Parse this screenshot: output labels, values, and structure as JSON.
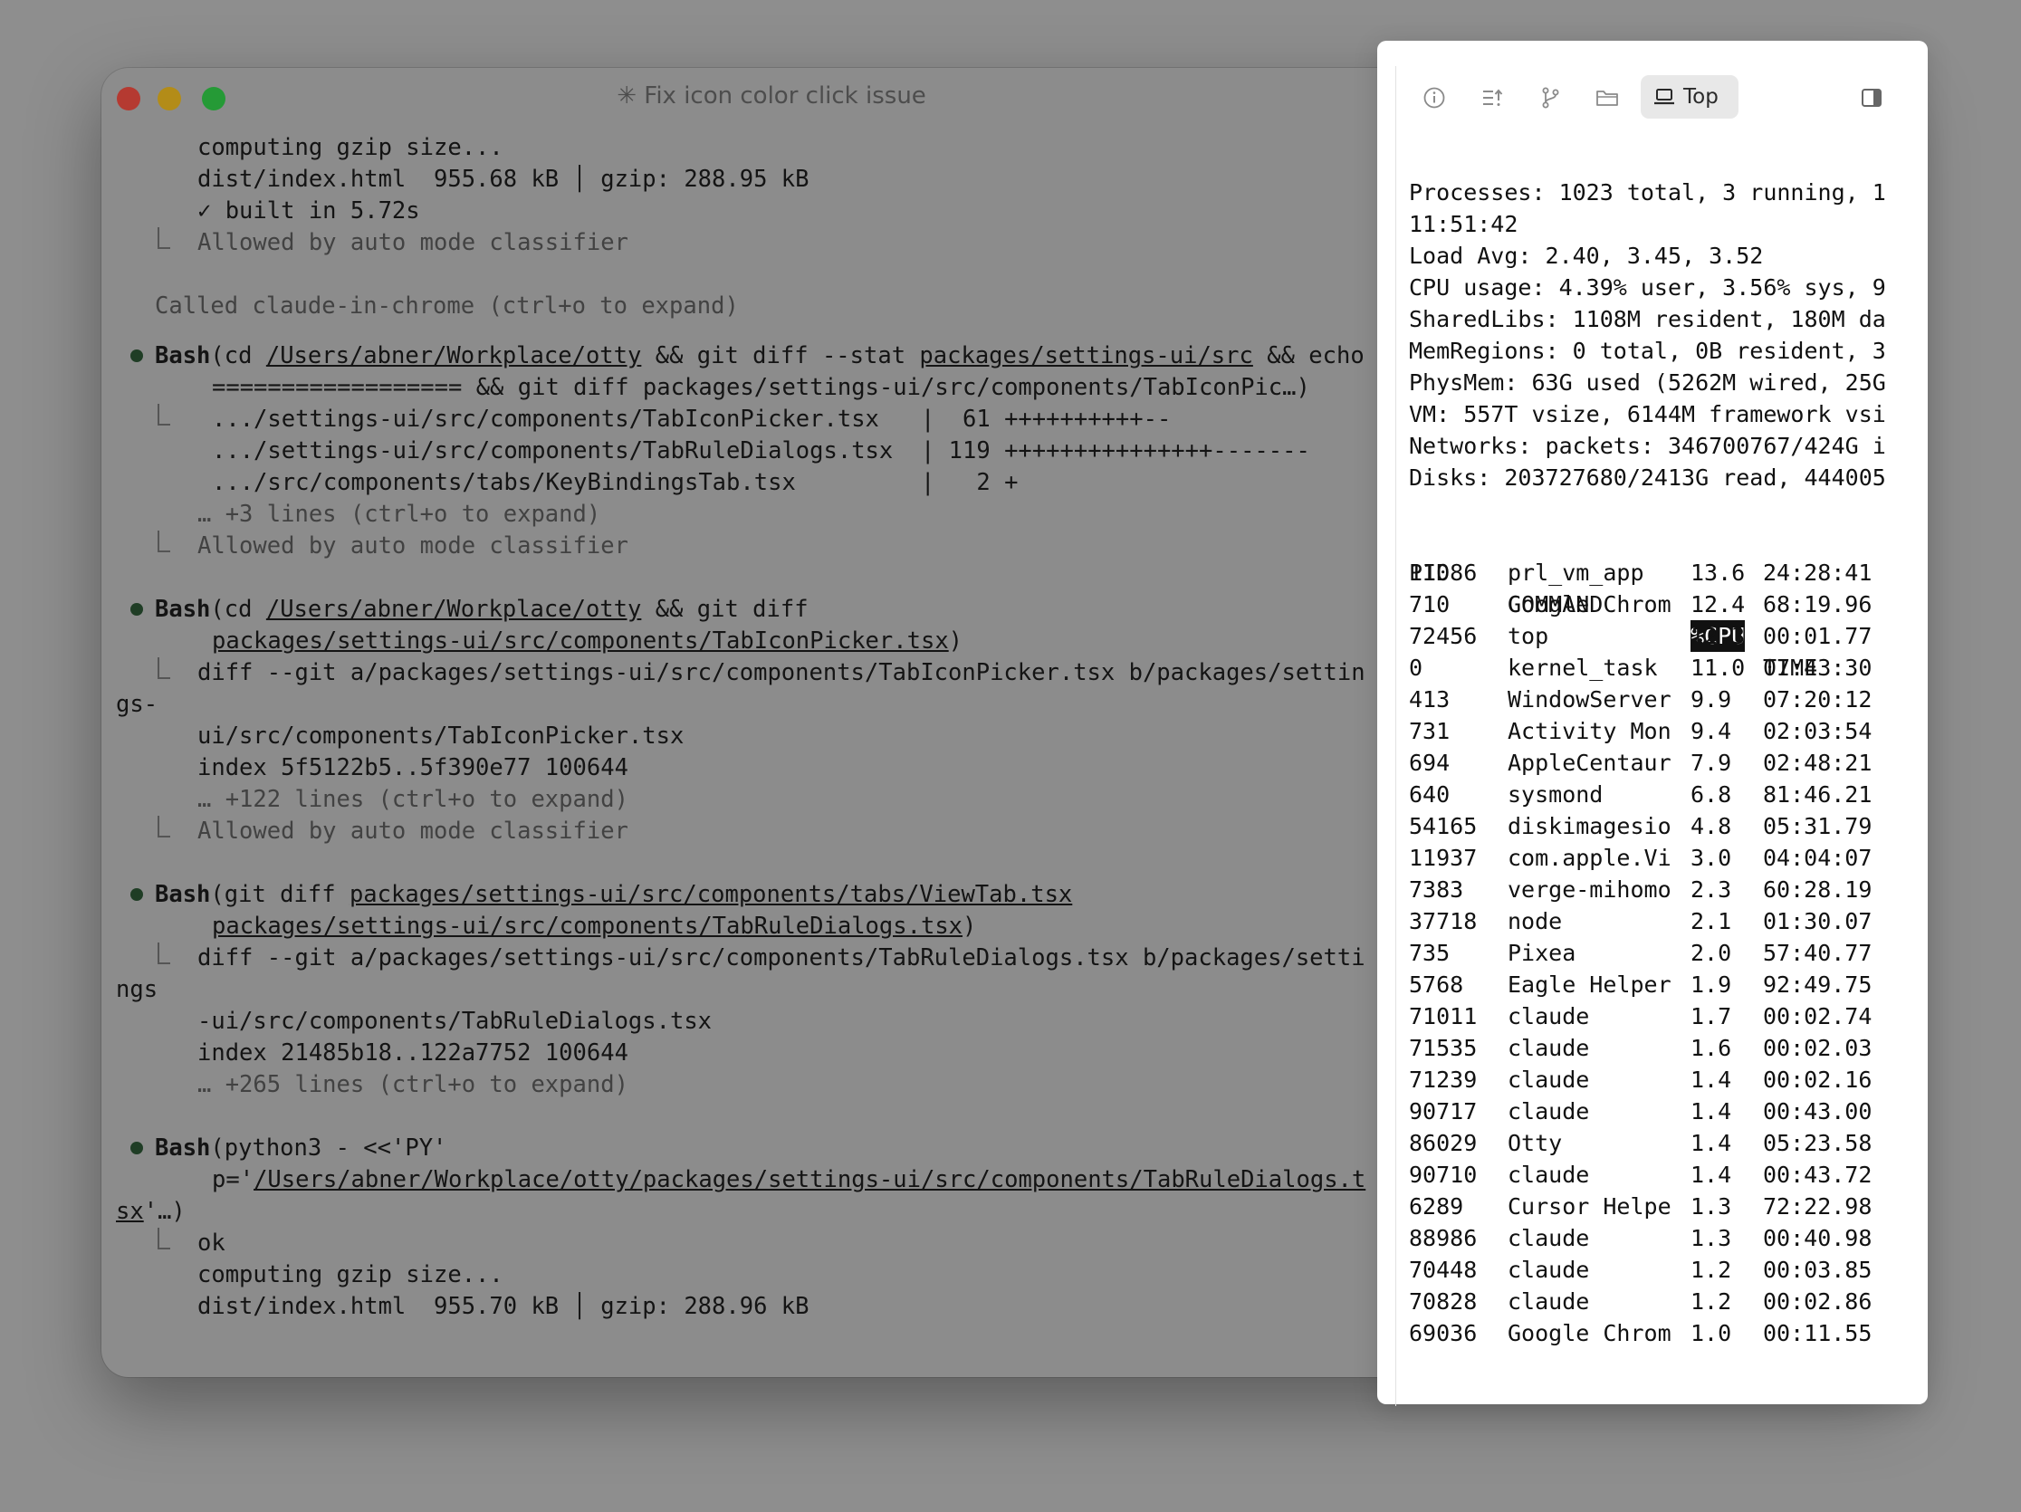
{
  "window": {
    "title": "✳ Fix icon color click issue"
  },
  "terminal": {
    "l1": "computing gzip size...",
    "l2": "dist/index.html  955.68 kB │ gzip: 288.95 kB",
    "l3": "✓ built in 5.72s",
    "l4": "Allowed by auto mode classifier",
    "l5": "Called claude-in-chrome (ctrl+o to expand)",
    "b1_cmd": "Bash",
    "b1_a": "(cd ",
    "b1_b": "/Users/abner/Workplace/otty",
    "b1_c": " && git diff --stat ",
    "b1_d": "packages/settings-ui/src",
    "b1_e": " && echo",
    "b1_l2": "================== && git diff packages/settings-ui/src/components/TabIconPic…)",
    "b1_r1": ".../settings-ui/src/components/TabIconPicker.tsx   |  61 ++++++++++--",
    "b1_r2": ".../settings-ui/src/components/TabRuleDialogs.tsx  | 119 +++++++++++++++-------",
    "b1_r3": ".../src/components/tabs/KeyBindingsTab.tsx         |   2 +",
    "b1_more": "… +3 lines (ctrl+o to expand)",
    "b1_allowed": "Allowed by auto mode classifier",
    "b2_cmd": "Bash",
    "b2_a": "(cd ",
    "b2_b": "/Users/abner/Workplace/otty",
    "b2_c": " && git diff",
    "b2_l2u": "packages/settings-ui/src/components/TabIconPicker.tsx",
    "b2_l2e": ")",
    "b2_r1": "diff --git a/packages/settings-ui/src/components/TabIconPicker.tsx b/packages/settin",
    "b2_r1w": "gs-",
    "b2_r2": "ui/src/components/TabIconPicker.tsx",
    "b2_r3": "index 5f5122b5..5f390e77 100644",
    "b2_more": "… +122 lines (ctrl+o to expand)",
    "b2_allowed": "Allowed by auto mode classifier",
    "b3_cmd": "Bash",
    "b3_a": "(git diff ",
    "b3_b": "packages/settings-ui/src/components/tabs/ViewTab.tsx",
    "b3_l2u": "packages/settings-ui/src/components/TabRuleDialogs.tsx",
    "b3_l2e": ")",
    "b3_r1": "diff --git a/packages/settings-ui/src/components/TabRuleDialogs.tsx b/packages/setti",
    "b3_r1w": "ngs",
    "b3_r2": "-ui/src/components/TabRuleDialogs.tsx",
    "b3_r3": "index 21485b18..122a7752 100644",
    "b3_more": "… +265 lines (ctrl+o to expand)",
    "b4_cmd": "Bash",
    "b4_a": "(python3 - <<'PY'",
    "b4_l2a": "p='",
    "b4_l2u": "/Users/abner/Workplace/otty/packages/settings-ui/src/components/TabRuleDialogs.t",
    "b4_l3u": "sx",
    "b4_l3e": "'…)",
    "b4_r1": "ok",
    "b4_r2": "computing gzip size...",
    "b4_r3": "dist/index.html  955.70 kB │ gzip: 288.96 kB"
  },
  "panel": {
    "toolbar": {
      "info_icon": "info-circle-icon",
      "list_icon": "list-sort-icon",
      "branch_icon": "git-branch-icon",
      "folder_icon": "folder-icon",
      "top_tab_label": "Top",
      "sidebar_icon": "sidebar-toggle-icon"
    },
    "summary": [
      "Processes: 1023 total, 3 running, 1",
      "11:51:42",
      "Load Avg: 2.40, 3.45, 3.52",
      "CPU usage: 4.39% user, 3.56% sys, 9",
      "SharedLibs: 1108M resident, 180M da",
      "MemRegions: 0 total, 0B resident, 3",
      "PhysMem: 63G used (5262M wired, 25G",
      "VM: 557T vsize, 6144M framework vsi",
      "Networks: packets: 346700767/424G i",
      "Disks: 203727680/2413G read, 444005"
    ],
    "headers": {
      "pid": "PID",
      "command": "COMMAND",
      "cpu": "%CPU",
      "time": "TIME"
    },
    "processes": [
      {
        "pid": "11086",
        "command": "prl_vm_app",
        "cpu": "13.6",
        "time": "24:28:41"
      },
      {
        "pid": "710",
        "command": "Google Chrom",
        "cpu": "12.4",
        "time": "68:19.96"
      },
      {
        "pid": "72456",
        "command": "top",
        "cpu": "12.3",
        "time": "00:01.77"
      },
      {
        "pid": "0",
        "command": "kernel_task",
        "cpu": "11.0",
        "time": "07:43:30"
      },
      {
        "pid": "413",
        "command": "WindowServer",
        "cpu": "9.9",
        "time": "07:20:12"
      },
      {
        "pid": "731",
        "command": "Activity Mon",
        "cpu": "9.4",
        "time": "02:03:54"
      },
      {
        "pid": "694",
        "command": "AppleCentaur",
        "cpu": "7.9",
        "time": "02:48:21"
      },
      {
        "pid": "640",
        "command": "sysmond",
        "cpu": "6.8",
        "time": "81:46.21"
      },
      {
        "pid": "54165",
        "command": "diskimagesio",
        "cpu": "4.8",
        "time": "05:31.79"
      },
      {
        "pid": "11937",
        "command": "com.apple.Vi",
        "cpu": "3.0",
        "time": "04:04:07"
      },
      {
        "pid": "7383",
        "command": "verge-mihomo",
        "cpu": "2.3",
        "time": "60:28.19"
      },
      {
        "pid": "37718",
        "command": "node",
        "cpu": "2.1",
        "time": "01:30.07"
      },
      {
        "pid": "735",
        "command": "Pixea",
        "cpu": "2.0",
        "time": "57:40.77"
      },
      {
        "pid": "5768",
        "command": "Eagle Helper",
        "cpu": "1.9",
        "time": "92:49.75"
      },
      {
        "pid": "71011",
        "command": "claude",
        "cpu": "1.7",
        "time": "00:02.74"
      },
      {
        "pid": "71535",
        "command": "claude",
        "cpu": "1.6",
        "time": "00:02.03"
      },
      {
        "pid": "71239",
        "command": "claude",
        "cpu": "1.4",
        "time": "00:02.16"
      },
      {
        "pid": "90717",
        "command": "claude",
        "cpu": "1.4",
        "time": "00:43.00"
      },
      {
        "pid": "86029",
        "command": "Otty",
        "cpu": "1.4",
        "time": "05:23.58"
      },
      {
        "pid": "90710",
        "command": "claude",
        "cpu": "1.4",
        "time": "00:43.72"
      },
      {
        "pid": "6289",
        "command": "Cursor Helpe",
        "cpu": "1.3",
        "time": "72:22.98"
      },
      {
        "pid": "88986",
        "command": "claude",
        "cpu": "1.3",
        "time": "00:40.98"
      },
      {
        "pid": "70448",
        "command": "claude",
        "cpu": "1.2",
        "time": "00:03.85"
      },
      {
        "pid": "70828",
        "command": "claude",
        "cpu": "1.2",
        "time": "00:02.86"
      },
      {
        "pid": "69036",
        "command": "Google Chrom",
        "cpu": "1.0",
        "time": "00:11.55"
      }
    ]
  }
}
